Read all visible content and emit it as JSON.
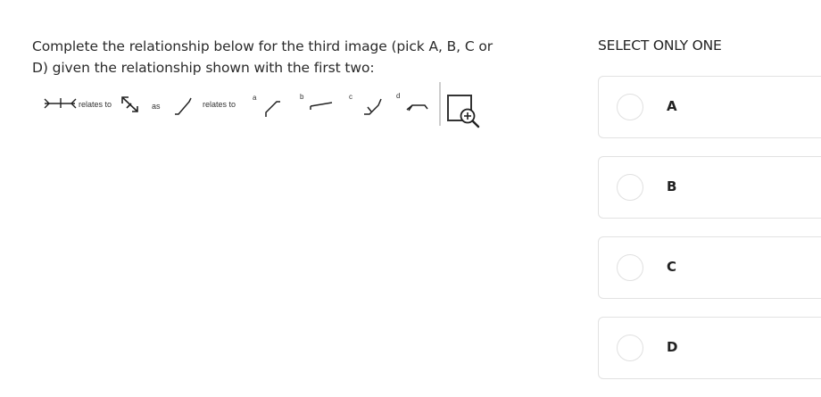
{
  "question": {
    "text": "Complete the relationship below for the third image (pick A, B, C or D) given the relationship shown with the first two:"
  },
  "puzzle": {
    "relates_to_1": "relates to",
    "as": "as",
    "relates_to_2": "relates to",
    "choice_letters": [
      "a",
      "b",
      "c",
      "d"
    ]
  },
  "zoom": {
    "icon": "zoom-in-icon"
  },
  "answers": {
    "heading": "SELECT ONLY ONE",
    "options": [
      {
        "label": "A"
      },
      {
        "label": "B"
      },
      {
        "label": "C"
      },
      {
        "label": "D"
      }
    ]
  }
}
